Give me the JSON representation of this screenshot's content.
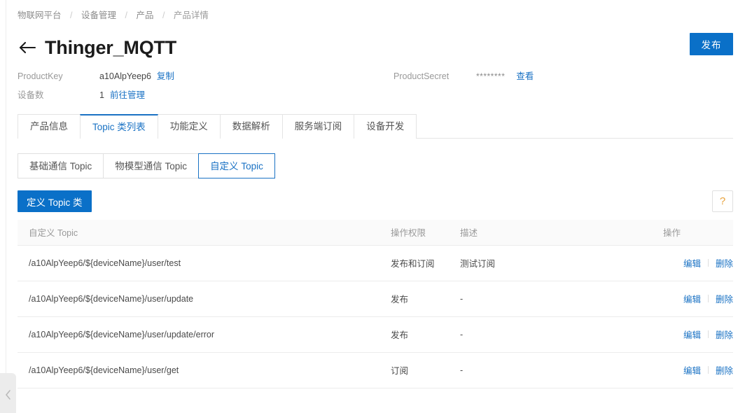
{
  "breadcrumb": {
    "separator": "/",
    "items": [
      {
        "label": "物联网平台"
      },
      {
        "label": "设备管理"
      },
      {
        "label": "产品"
      },
      {
        "label": "产品详情"
      }
    ]
  },
  "header": {
    "back_icon": "arrow-left-icon",
    "title": "Thinger_MQTT",
    "publish_label": "发布"
  },
  "meta": {
    "product_key_label": "ProductKey",
    "product_key_value": "a10AlpYeep6",
    "product_key_copy_label": "复制",
    "product_secret_label": "ProductSecret",
    "product_secret_value": "********",
    "product_secret_view_label": "查看",
    "device_count_label": "设备数",
    "device_count_value": "1",
    "device_manage_label": "前往管理"
  },
  "tabs": {
    "active_index": 1,
    "items": [
      {
        "label": "产品信息"
      },
      {
        "label": "Topic 类列表"
      },
      {
        "label": "功能定义"
      },
      {
        "label": "数据解析"
      },
      {
        "label": "服务端订阅"
      },
      {
        "label": "设备开发"
      }
    ]
  },
  "subtabs": {
    "active_index": 2,
    "items": [
      {
        "label": "基础通信 Topic"
      },
      {
        "label": "物模型通信 Topic"
      },
      {
        "label": "自定义 Topic"
      }
    ]
  },
  "actionbar": {
    "define_label": "定义 Topic 类",
    "help_icon": "question-mark-icon",
    "help_label": "?"
  },
  "table": {
    "columns": [
      {
        "key": "topic",
        "label": "自定义 Topic"
      },
      {
        "key": "perm",
        "label": "操作权限"
      },
      {
        "key": "desc",
        "label": "描述"
      },
      {
        "key": "action",
        "label": "操作"
      }
    ],
    "edit_label": "编辑",
    "delete_label": "删除",
    "rows": [
      {
        "topic": "/a10AlpYeep6/${deviceName}/user/test",
        "perm": "发布和订阅",
        "desc": "测试订阅"
      },
      {
        "topic": "/a10AlpYeep6/${deviceName}/user/update",
        "perm": "发布",
        "desc": "-"
      },
      {
        "topic": "/a10AlpYeep6/${deviceName}/user/update/error",
        "perm": "发布",
        "desc": "-"
      },
      {
        "topic": "/a10AlpYeep6/${deviceName}/user/get",
        "perm": "订阅",
        "desc": "-"
      }
    ]
  },
  "sidebar": {
    "collapse_icon": "chevron-left-icon"
  },
  "colors": {
    "primary": "#0a70c8",
    "link": "#1a72c4",
    "help_icon": "#e8a33d",
    "border": "#e4e4e4",
    "header_bg": "#fafafa"
  }
}
